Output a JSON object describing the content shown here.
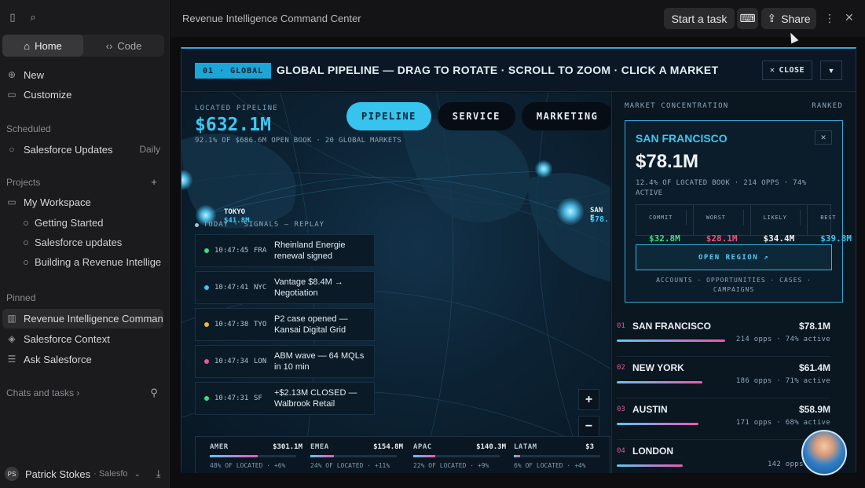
{
  "sidebar": {
    "seg": {
      "home": "Home",
      "code": "Code"
    },
    "new": "New",
    "customize": "Customize",
    "scheduled_head": "Scheduled",
    "scheduled": [
      {
        "label": "Salesforce Updates",
        "freq": "Daily"
      }
    ],
    "projects_head": "Projects",
    "workspace": "My Workspace",
    "projects": [
      "Getting Started",
      "Salesforce updates",
      "Building a Revenue Intellige"
    ],
    "pinned_head": "Pinned",
    "pinned": [
      "Revenue Intelligence Comman",
      "Salesforce Context",
      "Ask Salesforce"
    ],
    "chats_head": "Chats and tasks",
    "user_name": "Patrick Stokes",
    "user_org": "Salesfo",
    "user_initials": "PS"
  },
  "topbar": {
    "title": "Revenue Intelligence Command Center",
    "start_task": "Start a task",
    "share": "Share"
  },
  "panel": {
    "tag": "01 · GLOBAL",
    "title": "GLOBAL PIPELINE — DRAG TO ROTATE · SCROLL TO ZOOM · CLICK A MARKET",
    "close": "CLOSE",
    "kpi_label": "LOCATED PIPELINE",
    "kpi_value": "$632.1M",
    "kpi_sub": "92.1% OF $686.6M OPEN BOOK · 20 GLOBAL MARKETS",
    "tabs": [
      "PIPELINE",
      "SERVICE",
      "MARKETING"
    ],
    "map_labels": {
      "tokyo": "TOKYO",
      "tokyo_val": "$41.8M",
      "sf": "SAN F",
      "sf_val": "$78."
    },
    "signals_head": "TODAY · SIGNALS — REPLAY",
    "signals": [
      {
        "time": "10:47:45",
        "code": "FRA",
        "msg1": "Rheinland Energie",
        "msg2": "renewal signed",
        "color": "#3ddc84"
      },
      {
        "time": "10:47:41",
        "code": "NYC",
        "msg1": "Vantage $8.4M →",
        "msg2": "Negotiation",
        "color": "#3ec6f2"
      },
      {
        "time": "10:47:38",
        "code": "TYO",
        "msg1": "P2 case opened —",
        "msg2": "Kansai Digital Grid",
        "color": "#f2b53e"
      },
      {
        "time": "10:47:34",
        "code": "LON",
        "msg1": "ABM wave — 64 MQLs",
        "msg2": "in 10 min",
        "color": "#e8569c"
      },
      {
        "time": "10:47:31",
        "code": "SF",
        "msg1": "+$2.13M CLOSED —",
        "msg2": "Walbrook Retail",
        "color": "#3ddc84"
      }
    ],
    "zoom_in": "+",
    "zoom_out": "−",
    "reset": "⟲",
    "regions": [
      {
        "name": "AMER",
        "value": "$301.1M",
        "sub": "48% OF LOCATED · +6%",
        "pct": 0.48
      },
      {
        "name": "EMEA",
        "value": "$154.8M",
        "sub": "24% OF LOCATED · +11%",
        "pct": 0.24
      },
      {
        "name": "APAC",
        "value": "$140.3M",
        "sub": "22% OF LOCATED · +9%",
        "pct": 0.22
      },
      {
        "name": "LATAM",
        "value": "$3",
        "sub": "6% OF LOCATED · +4%",
        "pct": 0.06
      }
    ]
  },
  "side": {
    "head": "MARKET CONCENTRATION",
    "ranked": "RANKED",
    "card": {
      "title": "SAN FRANCISCO",
      "value": "$78.1M",
      "sub": "12.4% OF LOCATED BOOK · 214 OPPS · 74% ACTIVE",
      "forecast": [
        {
          "label": "COMMIT",
          "value": "$32.8M",
          "color": "#3ddc84"
        },
        {
          "label": "WORST",
          "value": "$28.1M",
          "color": "#f0507a"
        },
        {
          "label": "LIKELY",
          "value": "$34.4M",
          "color": "#f0f4f7"
        },
        {
          "label": "BEST",
          "value": "$39.8M",
          "color": "#3ec6f2"
        }
      ],
      "open": "OPEN REGION ↗",
      "links": "ACCOUNTS · OPPORTUNITIES · CASES · CAMPAIGNS"
    },
    "ranks": [
      {
        "idx": "01",
        "name": "SAN FRANCISCO",
        "value": "$78.1M",
        "sub": "214 opps · 74% active",
        "pct": 1.0
      },
      {
        "idx": "02",
        "name": "NEW YORK",
        "value": "$61.4M",
        "sub": "186 opps · 71% active",
        "pct": 0.79
      },
      {
        "idx": "03",
        "name": "AUSTIN",
        "value": "$58.9M",
        "sub": "171 opps · 68% active",
        "pct": 0.75
      },
      {
        "idx": "04",
        "name": "LONDON",
        "value": "",
        "sub": "142 opps · 69%",
        "pct": 0.61
      }
    ]
  }
}
